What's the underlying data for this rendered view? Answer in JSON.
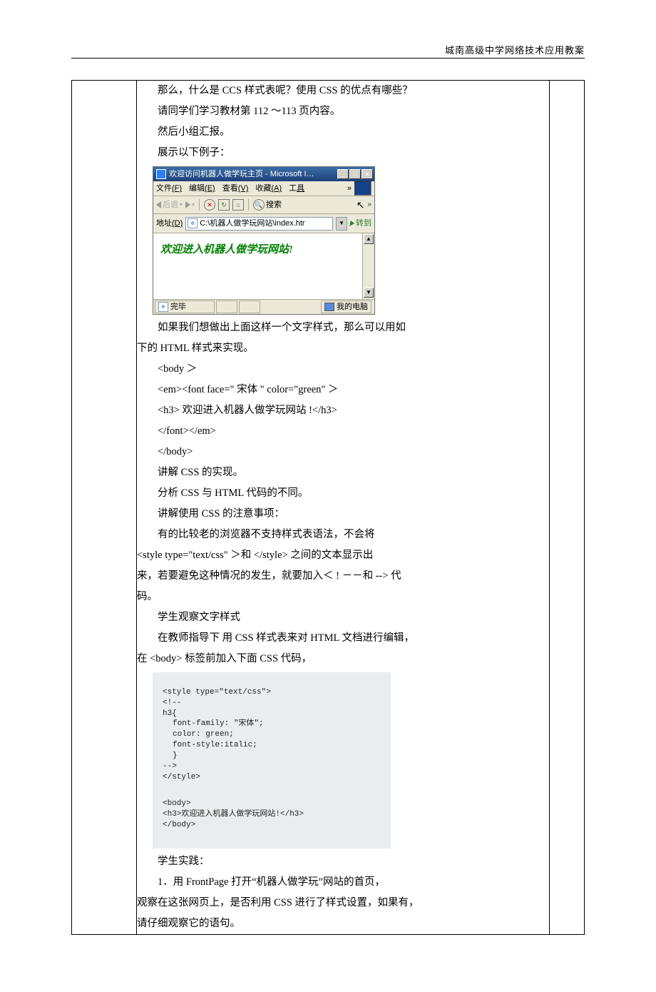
{
  "header": {
    "text": "城南高级中学网络技术应用教案"
  },
  "para": {
    "p1": "那么，什么是 CCS 样式表呢？使用 CSS 的优点有哪些？",
    "p2": "请同学们学习教材第 112 ～113 页内容。",
    "p3": "然后小组汇报。",
    "p4": "展示以下例子：",
    "p5a": "如果我们想做出上面这样一个文字样式，那么可以用如",
    "p5b": "下的 HTML 样式来实现。",
    "code1": "<body ＞",
    "code2": "<em><font face=\" 宋体 \" color=\"green\" ＞",
    "code3": "<h3> 欢迎进入机器人做学玩网站 !</h3>",
    "code4": "</font></em>",
    "code5": "</body>",
    "p6": "讲解 CSS 的实现。",
    "p7": "分析 CSS 与 HTML 代码的不同。",
    "p8": "讲解使用 CSS 的注意事项：",
    "p9a": "有的比较老的浏览器不支持样式表语法，不会将",
    "p9b": "<style type=\"text/css\" ＞和 </style> 之间的文本显示出",
    "p9c": "来，若要避免这种情况的发生，就要加入＜ ! －－和 --> 代",
    "p9d": "码。",
    "p10": "学生观察文字样式",
    "p11a": "在教师指导下 用 CSS 样式表来对 HTML 文档进行编辑，",
    "p11b": "在 <body> 标签前加入下面 CSS 代码，",
    "p12": "学生实践：",
    "p13a": "1．用 FrontPage 打开“机器人做学玩”网站的首页，",
    "p13b": "观察在这张网页上，是否利用 CSS 进行了样式设置，如果有，",
    "p13c": "请仔细观察它的语句。"
  },
  "ie": {
    "title": "欢迎访问机器人做学玩主页 - Microsoft I…",
    "menu": {
      "file": "文件",
      "file_k": "(F)",
      "edit": "编辑",
      "edit_k": "(E)",
      "view": "查看",
      "view_k": "(V)",
      "fav": "收藏",
      "fav_k": "(A)",
      "tool": "工",
      "tool_k": "具",
      "more": "»"
    },
    "toolbar": {
      "back": "后退",
      "search": "搜索",
      "more": "»"
    },
    "address": {
      "label": "地址",
      "label_k": "(D)",
      "value": "C:\\机器人做学玩网站\\index.htr",
      "go": "转到"
    },
    "content": {
      "welcome": "欢迎进入机器人做学玩网站!"
    },
    "status": {
      "done": "完毕",
      "mycomputer": "我的电脑"
    },
    "winbtn": {
      "min": "_",
      "max": "□",
      "close": "×"
    }
  },
  "css_code": {
    "l1": "<style type=\"text/css\">",
    "l2": "<!--",
    "l3": "h3{",
    "l4": "font-family: \"宋体\";",
    "l5": "color: green;",
    "l6": "font-style:italic;",
    "l7": "}",
    "l8": "-->",
    "l9": "</style>",
    "l10": "<body>",
    "l11": "<h3>欢迎进入机器人做学玩网站!</h3>",
    "l12": "</body>"
  }
}
